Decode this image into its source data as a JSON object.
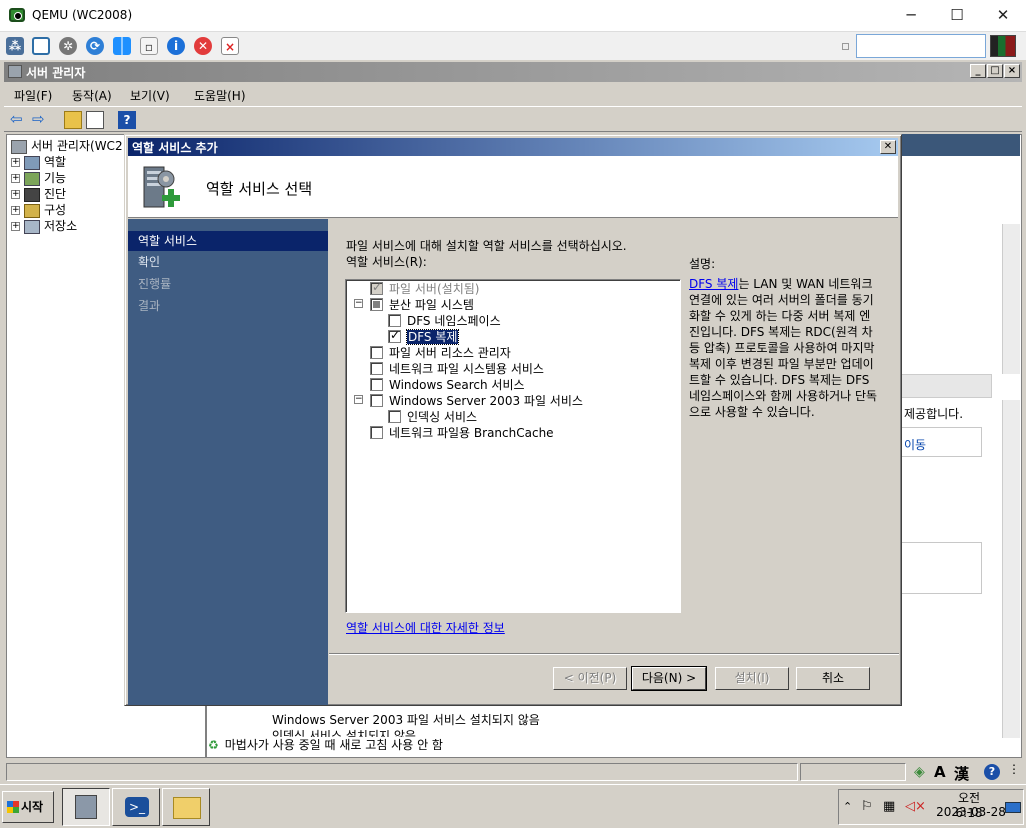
{
  "host": {
    "title": "QEMU (WC2008)",
    "minimize": "─",
    "maximize": "☐",
    "close": "✕"
  },
  "server_manager": {
    "title": "서버 관리자",
    "menu": [
      "파일(F)",
      "동작(A)",
      "보기(V)",
      "도움말(H)"
    ],
    "tree": {
      "root": "서버 관리자(WC2",
      "items": [
        "역할",
        "기능",
        "진단",
        "구성",
        "저장소"
      ]
    },
    "background": {
      "text1": "제공합니다.",
      "text2": "이동",
      "row1": "Windows Server 2003 파일 서비스   설치되지 않음",
      "row2": "인덱싱 서비스                       설치되지 않음",
      "refresh": "마법사가 사용 중일 때 새로 고침 사용 안 함"
    }
  },
  "dialog": {
    "title": "역할 서비스 추가",
    "heading": "역할 서비스 선택",
    "close": "✕",
    "nav": [
      {
        "label": "역할 서비스",
        "state": "active"
      },
      {
        "label": "확인",
        "state": "normal"
      },
      {
        "label": "진행률",
        "state": "dim"
      },
      {
        "label": "결과",
        "state": "dim"
      }
    ],
    "instruction": "파일 서비스에 대해 설치할 역할 서비스를 선택하십시오.",
    "list_label": "역할 서비스(R):",
    "services": [
      {
        "label": "파일 서버(설치됨)",
        "checked": true,
        "disabled": true,
        "indent": 0
      },
      {
        "label": "분산 파일 시스템",
        "partial": true,
        "toggle": "−",
        "indent": 0
      },
      {
        "label": "DFS 네임스페이스",
        "checked": false,
        "indent": 1
      },
      {
        "label": "DFS 복제",
        "checked": true,
        "selected": true,
        "indent": 1
      },
      {
        "label": "파일 서버 리소스 관리자",
        "checked": false,
        "indent": 0
      },
      {
        "label": "네트워크 파일 시스템용 서비스",
        "checked": false,
        "indent": 0
      },
      {
        "label": "Windows Search 서비스",
        "checked": false,
        "indent": 0
      },
      {
        "label": "Windows Server 2003 파일 서비스",
        "checked": false,
        "toggle": "−",
        "indent": 0
      },
      {
        "label": "인덱싱 서비스",
        "checked": false,
        "indent": 1
      },
      {
        "label": "네트워크 파일용 BranchCache",
        "checked": false,
        "indent": 0
      }
    ],
    "description_label": "설명:",
    "description_link": "DFS 복제",
    "description_text": "는 LAN 및 WAN 네트워크 연결에 있는 여러 서버의 폴더를 동기화할 수 있게 하는 다중 서버 복제 엔진입니다. DFS 복제는 RDC(원격 차등 압축) 프로토콜을 사용하여 마지막 복제 이후 변경된 파일 부분만 업데이트할 수 있습니다. DFS 복제는 DFS 네임스페이스와 함께 사용하거나 단독으로 사용할 수 있습니다.",
    "more_info": "역할 서비스에 대한 자세한 정보",
    "buttons": {
      "prev": "< 이전(P)",
      "next": "다음(N) >",
      "install": "설치(I)",
      "cancel": "취소"
    }
  },
  "taskbar": {
    "start": "시작",
    "time": "오전 6:18",
    "date": "2023-03-28"
  }
}
